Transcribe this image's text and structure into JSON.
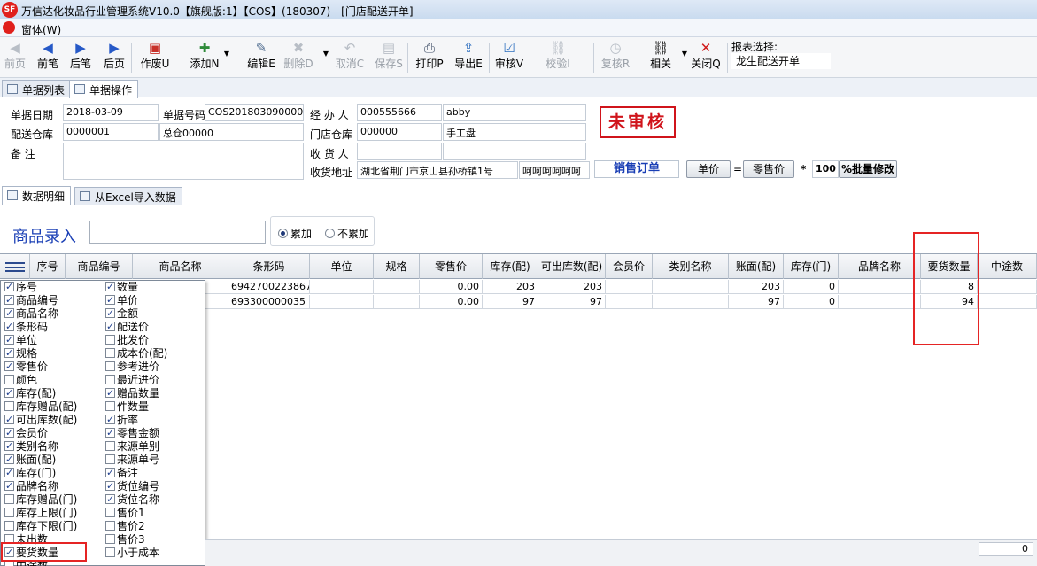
{
  "window": {
    "title": "万信达化妆品行业管理系统V10.0【旗舰版:1】【COS】(180307) - [门店配送开单]"
  },
  "menu": {
    "window_label": "窗体(W)"
  },
  "toolbar": {
    "buttons": [
      {
        "label": "前页",
        "icon": "first-page-icon",
        "enabled": false
      },
      {
        "label": "前笔",
        "icon": "prev-record-icon",
        "enabled": true
      },
      {
        "label": "后笔",
        "icon": "next-record-icon",
        "enabled": true
      },
      {
        "label": "后页",
        "icon": "last-page-icon",
        "enabled": true
      },
      {
        "label": "作废U",
        "icon": "void-icon",
        "enabled": true
      },
      {
        "label": "添加N",
        "icon": "add-icon",
        "enabled": true
      },
      {
        "label": "编辑E",
        "icon": "edit-icon",
        "enabled": true
      },
      {
        "label": "删除D",
        "icon": "delete-icon",
        "enabled": false
      },
      {
        "label": "取消C",
        "icon": "undo-icon",
        "enabled": false
      },
      {
        "label": "保存S",
        "icon": "save-icon",
        "enabled": false
      },
      {
        "label": "打印P",
        "icon": "print-icon",
        "enabled": true
      },
      {
        "label": "导出E",
        "icon": "export-icon",
        "enabled": true
      },
      {
        "label": "审核V",
        "icon": "audit-icon",
        "enabled": true
      },
      {
        "label": "校验I",
        "icon": "verify-icon",
        "enabled": false
      },
      {
        "label": "复核R",
        "icon": "recheck-icon",
        "enabled": false
      },
      {
        "label": "相关",
        "icon": "related-icon",
        "enabled": true
      },
      {
        "label": "关闭Q",
        "icon": "close-icon",
        "enabled": true
      }
    ],
    "report_label": "报表选择:",
    "report_value": "龙生配送开单"
  },
  "tabs": {
    "list": "单据列表",
    "operation": "单据操作"
  },
  "form": {
    "date_label": "单据日期",
    "date_value": "2018-03-09",
    "no_label": "单据号码",
    "no_value": "COS2018030900000001",
    "handler_label": "经 办 人",
    "handler_code": "000555666",
    "handler_name": "abby",
    "dist_label": "配送仓库",
    "dist_code": "0000001",
    "dist_name": "总仓00000",
    "store_label": "门店仓库",
    "store_code": "000000",
    "store_name": "手工盘",
    "remark_label": "备    注",
    "remark_value": "",
    "receiver_label": "收 货 人",
    "receiver_value": "",
    "address_label": "收货地址",
    "address_value": "湖北省荆门市京山县孙桥镇1号",
    "address_extra": "呵呵呵呵呵呵",
    "status_stamp": "未审核",
    "order_type": "销售订单",
    "unit_price_btn": "单价",
    "equals": "=",
    "retail_btn": "零售价",
    "times": "*",
    "percent": "100",
    "batch_btn": "%批量修改"
  },
  "subtabs": {
    "detail": "数据明细",
    "excel": "从Excel导入数据"
  },
  "entry": {
    "label": "商品录入",
    "input_value": "",
    "radio_accumulate": "累加",
    "radio_no_accumulate": "不累加",
    "selected": "累加"
  },
  "grid": {
    "headers": [
      "序号",
      "商品编号",
      "商品名称",
      "条形码",
      "单位",
      "规格",
      "零售价",
      "库存(配)",
      "可出库数(配)",
      "会员价",
      "类别名称",
      "账面(配)",
      "库存(门)",
      "品牌名称",
      "要货数量",
      "中途数"
    ],
    "rows": [
      [
        "",
        "",
        "",
        "6942700223867",
        "",
        "",
        "0.00",
        "203",
        "203",
        "",
        "",
        "203",
        "0",
        "",
        "8",
        ""
      ],
      [
        "",
        "",
        "",
        "693300000035",
        "",
        "",
        "0.00",
        "97",
        "97",
        "",
        "",
        "97",
        "0",
        "",
        "94",
        ""
      ]
    ],
    "status_total": "0"
  },
  "column_chooser": {
    "col1": [
      {
        "label": "序号",
        "checked": true
      },
      {
        "label": "商品编号",
        "checked": true
      },
      {
        "label": "商品名称",
        "checked": true
      },
      {
        "label": "条形码",
        "checked": true
      },
      {
        "label": "单位",
        "checked": true
      },
      {
        "label": "规格",
        "checked": true
      },
      {
        "label": "零售价",
        "checked": true
      },
      {
        "label": "颜色",
        "checked": false
      },
      {
        "label": "库存(配)",
        "checked": true
      },
      {
        "label": "库存赠品(配)",
        "checked": false
      },
      {
        "label": "可出库数(配)",
        "checked": true
      },
      {
        "label": "会员价",
        "checked": true
      },
      {
        "label": "类别名称",
        "checked": true
      },
      {
        "label": "账面(配)",
        "checked": true
      },
      {
        "label": "库存(门)",
        "checked": true
      },
      {
        "label": "品牌名称",
        "checked": true
      },
      {
        "label": "库存赠品(门)",
        "checked": false
      },
      {
        "label": "库存上限(门)",
        "checked": false
      },
      {
        "label": "库存下限(门)",
        "checked": false
      },
      {
        "label": "未出数",
        "checked": false
      },
      {
        "label": "要货数量",
        "checked": true
      },
      {
        "label": "中途数",
        "checked": false
      }
    ],
    "col2": [
      {
        "label": "数量",
        "checked": true
      },
      {
        "label": "单价",
        "checked": true
      },
      {
        "label": "金额",
        "checked": true
      },
      {
        "label": "配送价",
        "checked": true
      },
      {
        "label": "批发价",
        "checked": false
      },
      {
        "label": "成本价(配)",
        "checked": false
      },
      {
        "label": "参考进价",
        "checked": false
      },
      {
        "label": "最近进价",
        "checked": false
      },
      {
        "label": "赠品数量",
        "checked": true
      },
      {
        "label": "件数量",
        "checked": false
      },
      {
        "label": "折率",
        "checked": true
      },
      {
        "label": "零售金额",
        "checked": true
      },
      {
        "label": "来源单别",
        "checked": false
      },
      {
        "label": "来源单号",
        "checked": false
      },
      {
        "label": "备注",
        "checked": true
      },
      {
        "label": "货位编号",
        "checked": true
      },
      {
        "label": "货位名称",
        "checked": true
      },
      {
        "label": "售价1",
        "checked": false
      },
      {
        "label": "售价2",
        "checked": false
      },
      {
        "label": "售价3",
        "checked": false
      },
      {
        "label": "小于成本",
        "checked": false
      }
    ]
  },
  "colors": {
    "accent_red": "#e52424",
    "stamp_red": "#d0141b",
    "label_blue": "#1a3fb5"
  }
}
